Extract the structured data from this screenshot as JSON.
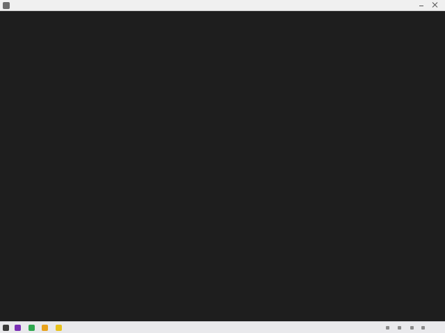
{
  "window": {
    "title": "",
    "menu": [
      "",
      ""
    ]
  },
  "editor": {
    "colors": {
      "background": "#1e1e1e",
      "line_number": "#7a7a7a",
      "text": "#d4d4d4",
      "keyword": "#569cd6",
      "string": "#ce9178",
      "function": "#dcdcaa",
      "comment": "#6a9955",
      "number": "#b5cea8",
      "identifier": "#9cdcfe"
    },
    "lines": [
      {
        "n": "",
        "text": ""
      },
      {
        "n": "",
        "text": ""
      },
      {
        "n": "",
        "text": ""
      },
      {
        "n": "",
        "text": ""
      },
      {
        "n": "",
        "text": ""
      },
      {
        "n": "",
        "text": ""
      },
      {
        "n": "",
        "text": ""
      },
      {
        "n": "",
        "text": ""
      },
      {
        "n": "",
        "text": ""
      },
      {
        "n": "",
        "text": ""
      },
      {
        "n": "",
        "text": ""
      },
      {
        "n": "",
        "text": ""
      },
      {
        "n": "",
        "text": ""
      },
      {
        "n": "",
        "text": ""
      },
      {
        "n": "",
        "text": ""
      },
      {
        "n": "",
        "text": ""
      },
      {
        "n": "",
        "text": ""
      },
      {
        "n": "",
        "text": ""
      },
      {
        "n": "",
        "text": ""
      },
      {
        "n": "",
        "text": ""
      },
      {
        "n": "",
        "text": ""
      },
      {
        "n": "",
        "text": ""
      },
      {
        "n": "",
        "text": ""
      },
      {
        "n": "",
        "text": ""
      },
      {
        "n": "",
        "text": ""
      },
      {
        "n": "",
        "text": ""
      },
      {
        "n": "",
        "text": ""
      },
      {
        "n": "",
        "text": ""
      },
      {
        "n": "",
        "text": ""
      },
      {
        "n": "",
        "text": ""
      },
      {
        "n": "",
        "text": ""
      },
      {
        "n": "",
        "text": ""
      },
      {
        "n": "",
        "text": ""
      },
      {
        "n": "",
        "text": ""
      },
      {
        "n": "",
        "text": ""
      },
      {
        "n": "",
        "text": ""
      },
      {
        "n": "",
        "text": ""
      },
      {
        "n": "",
        "text": ""
      },
      {
        "n": "",
        "text": ""
      },
      {
        "n": "",
        "text": ""
      },
      {
        "n": "",
        "text": ""
      },
      {
        "n": "",
        "text": ""
      },
      {
        "n": "",
        "text": ""
      },
      {
        "n": "",
        "text": ""
      },
      {
        "n": "",
        "text": ""
      },
      {
        "n": "",
        "text": ""
      },
      {
        "n": "",
        "text": ""
      },
      {
        "n": "",
        "text": ""
      },
      {
        "n": "",
        "text": ""
      }
    ]
  },
  "taskbar": {
    "pinned_apps": [
      {
        "icon": "terminal-icon",
        "color": "#3a3a3a"
      },
      {
        "icon": "app-icon",
        "color": "#7a2fb5"
      },
      {
        "icon": "messaging-icon",
        "color": "#2fa84f"
      },
      {
        "icon": "files-icon",
        "color": "#e8a21c"
      },
      {
        "icon": "notes-icon",
        "color": "#e8c21c"
      }
    ],
    "tray": [
      {
        "icon": "network-icon"
      },
      {
        "icon": "volume-icon"
      },
      {
        "icon": "battery-icon"
      },
      {
        "icon": "power-icon"
      }
    ]
  }
}
